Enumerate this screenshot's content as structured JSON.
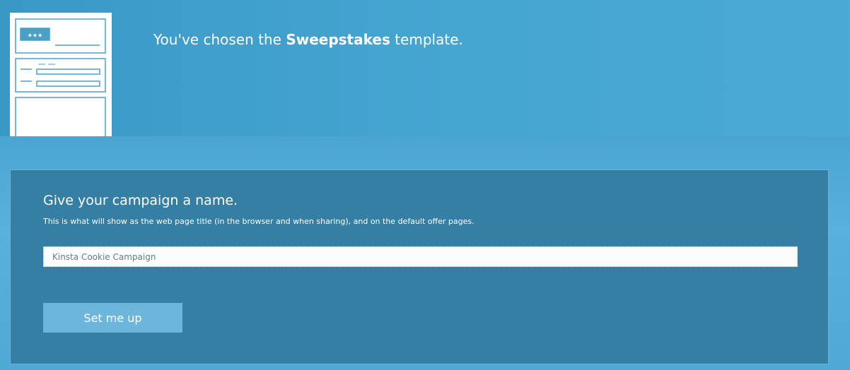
{
  "header": {
    "prefix": "You've chosen the ",
    "template_name": "Sweepstakes",
    "suffix": " template."
  },
  "thumbnail": {
    "icon": "sweepstakes-template-icon",
    "badge_text": "★★★"
  },
  "form": {
    "title": "Give your campaign a name.",
    "subtitle": "This is what will show as the web page title (in the browser and when sharing), and on the default offer pages.",
    "campaign_name_value": "Kinsta Cookie Campaign",
    "submit_label": "Set me up"
  },
  "colors": {
    "panel": "#347fa3",
    "button": "#6bb6da",
    "outline": "#4a9fc7"
  }
}
